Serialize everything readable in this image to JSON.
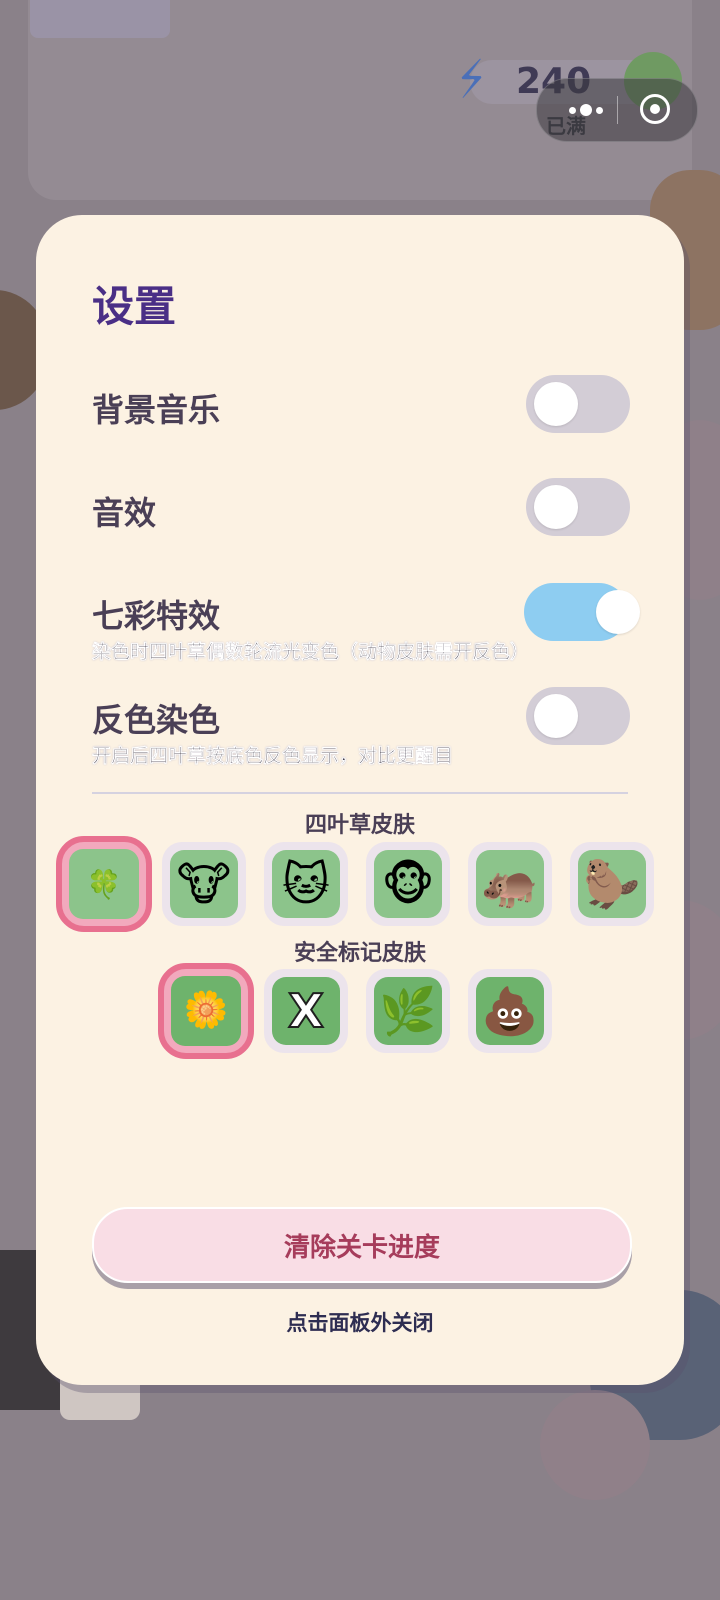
{
  "background": {
    "energy_value": "240",
    "energy_status": "已满"
  },
  "panel": {
    "title": "设置",
    "settings": [
      {
        "label": "背景音乐",
        "description": "",
        "enabled": false
      },
      {
        "label": "音效",
        "description": "",
        "enabled": false
      },
      {
        "label": "七彩特效",
        "description": "染色时四叶草偶数轮流光变色（动物皮肤需开反色）",
        "enabled": true
      },
      {
        "label": "反色染色",
        "description": "开启后四叶草按底色反色显示，对比更醒目",
        "enabled": false
      }
    ],
    "clover_skins": {
      "title": "四叶草皮肤",
      "items": [
        {
          "icon": "🍀",
          "name": "clover-icon",
          "selected": true
        },
        {
          "icon": "🐮",
          "name": "cow-icon",
          "selected": false
        },
        {
          "icon": "🐱",
          "name": "cat-icon",
          "selected": false
        },
        {
          "icon": "🐵",
          "name": "monkey-icon",
          "selected": false
        },
        {
          "icon": "🦛",
          "name": "hippo-icon",
          "selected": false
        },
        {
          "icon": "🦫",
          "name": "capybara-icon",
          "selected": false
        }
      ]
    },
    "safe_mark_skins": {
      "title": "安全标记皮肤",
      "items": [
        {
          "icon": "🌼",
          "name": "flower-icon",
          "selected": true
        },
        {
          "icon": "X",
          "name": "x-mark-icon",
          "selected": false
        },
        {
          "icon": "🌿",
          "name": "grass-icon",
          "selected": false
        },
        {
          "icon": "💩",
          "name": "poop-icon",
          "selected": false
        }
      ]
    },
    "clear_button_label": "清除关卡进度",
    "close_hint": "点击面板外关闭"
  },
  "colors": {
    "title": "#4a2f86",
    "toggle_on": "#8ecdf1",
    "toggle_off": "#d3cdd6",
    "selected_border": "#e8708f",
    "clear_text": "#a63c5b"
  }
}
